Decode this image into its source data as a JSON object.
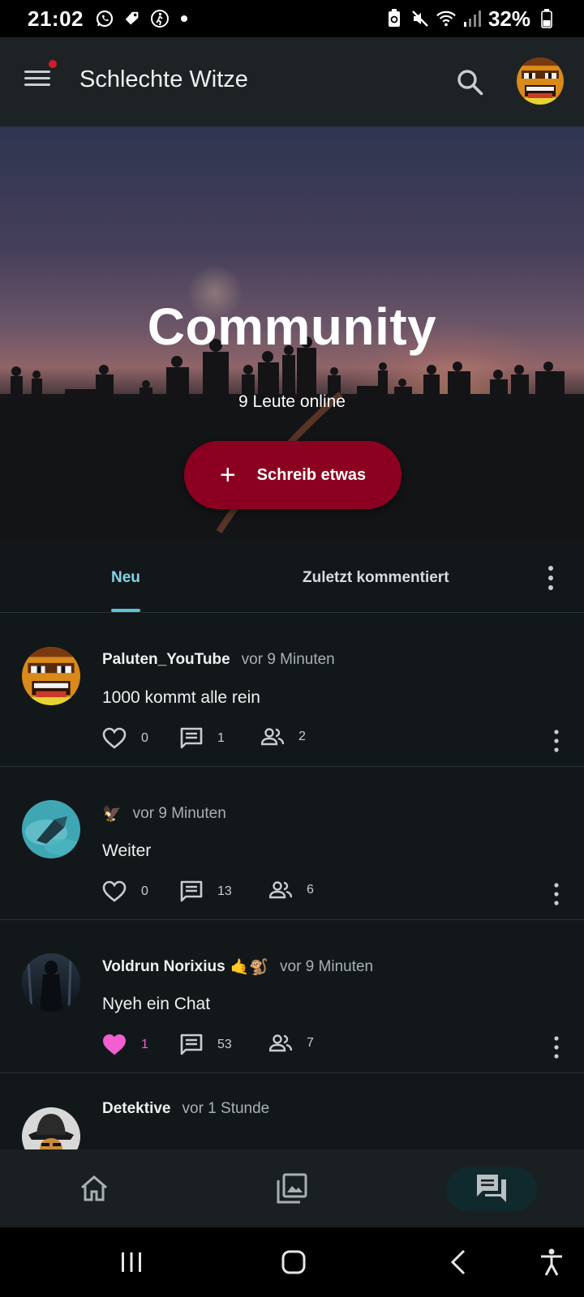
{
  "status_bar": {
    "time": "21:02",
    "battery": "32%",
    "left_icons": [
      "whatsapp-icon",
      "tag-icon",
      "walking-icon",
      "dot-icon"
    ],
    "right_icons": [
      "battery-saver-icon",
      "mute-icon",
      "wifi-icon",
      "signal-icon",
      "battery-icon"
    ]
  },
  "app_bar": {
    "title": "Schlechte Witze",
    "menu_badge_color": "#d21b2c"
  },
  "hero": {
    "title": "Community",
    "online_text": "9 Leute online",
    "button_label": "Schreib etwas",
    "button_color": "#8b0020"
  },
  "tabs": {
    "active": "Neu",
    "items": [
      "Neu",
      "Zuletzt kommentiert"
    ],
    "accent": "#7fd6e6"
  },
  "posts": [
    {
      "author": "Paluten_YouTube",
      "author_emoji": "",
      "time": "vor 9 Minuten",
      "text": "1000 kommt alle rein",
      "likes": "0",
      "liked": false,
      "comments": "1",
      "members": "2"
    },
    {
      "author": "",
      "author_emoji": "🦅",
      "time": "vor 9 Minuten",
      "text": "Weiter",
      "likes": "0",
      "liked": false,
      "comments": "13",
      "members": "6"
    },
    {
      "author": "Voldrun Norixius",
      "author_emoji": "🤙🐒",
      "time": "vor 9 Minuten",
      "text": "Nyeh ein Chat",
      "likes": "1",
      "liked": true,
      "comments": "53",
      "members": "7"
    },
    {
      "author": "Detektive",
      "author_emoji": "",
      "time": "vor 1 Stunde",
      "text": "",
      "likes": "",
      "liked": false,
      "comments": "",
      "members": ""
    }
  ],
  "bottom_nav": {
    "items": [
      "home-icon",
      "gallery-icon",
      "chat-icon"
    ],
    "active": "chat-icon"
  },
  "colors": {
    "background": "#121719",
    "like_active": "#f15fd0"
  }
}
